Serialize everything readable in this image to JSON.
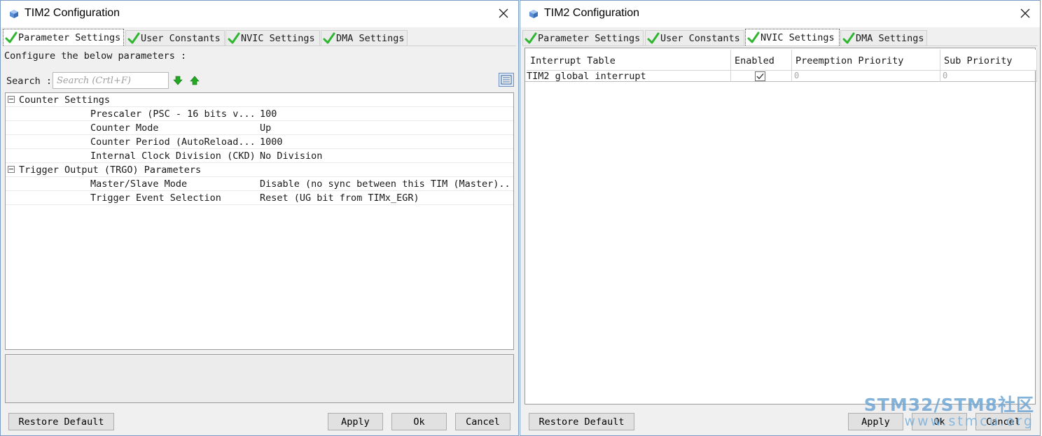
{
  "left_window": {
    "title": "TIM2 Configuration",
    "tabs": [
      {
        "label": "Parameter Settings"
      },
      {
        "label": "User Constants"
      },
      {
        "label": "NVIC Settings"
      },
      {
        "label": "DMA Settings"
      }
    ],
    "active_tab": "Parameter Settings",
    "config_label": "Configure the below parameters :",
    "search": {
      "label": "Search :",
      "placeholder": "Search (Crtl+F)"
    },
    "groups": [
      {
        "label": "Counter Settings",
        "params": [
          {
            "name": "Prescaler (PSC - 16 bits v...",
            "value": "100"
          },
          {
            "name": "Counter Mode",
            "value": "Up"
          },
          {
            "name": "Counter Period (AutoReload...",
            "value": "1000"
          },
          {
            "name": "Internal Clock Division (CKD)",
            "value": "No Division"
          }
        ]
      },
      {
        "label": "Trigger Output (TRGO) Parameters",
        "params": [
          {
            "name": "Master/Slave Mode",
            "value": "Disable (no sync between this TIM (Master)..."
          },
          {
            "name": "Trigger Event Selection",
            "value": "Reset (UG bit from TIMx_EGR)"
          }
        ]
      }
    ],
    "buttons": {
      "restore": "Restore Default",
      "apply": "Apply",
      "ok": "Ok",
      "cancel": "Cancel"
    }
  },
  "right_window": {
    "title": "TIM2 Configuration",
    "tabs": [
      {
        "label": "Parameter Settings"
      },
      {
        "label": "User Constants"
      },
      {
        "label": "NVIC Settings"
      },
      {
        "label": "DMA Settings"
      }
    ],
    "active_tab": "NVIC Settings",
    "table": {
      "headers": [
        "Interrupt Table",
        "Enabled",
        "Preemption Priority",
        "Sub Priority"
      ],
      "rows": [
        {
          "name": "TIM2 global interrupt",
          "enabled": true,
          "preemption": "0",
          "sub": "0"
        }
      ]
    },
    "buttons": {
      "restore": "Restore Default",
      "apply": "Apply",
      "ok": "Ok",
      "cancel": "Cancel"
    }
  },
  "watermark": {
    "line1": "STM32/STM8社区",
    "line2": "www.stmcu.org"
  },
  "colors": {
    "check_green": "#2fb52f",
    "arrow_green": "#22a822",
    "window_border": "#7a9cc6",
    "watermark": "#6fa6d4"
  },
  "icons": {
    "title": "cube-icon",
    "close": "close-icon",
    "tab_status": "check-icon",
    "search_next": "arrow-down-icon",
    "search_prev": "arrow-up-icon",
    "view_toggle": "list-view-icon"
  }
}
